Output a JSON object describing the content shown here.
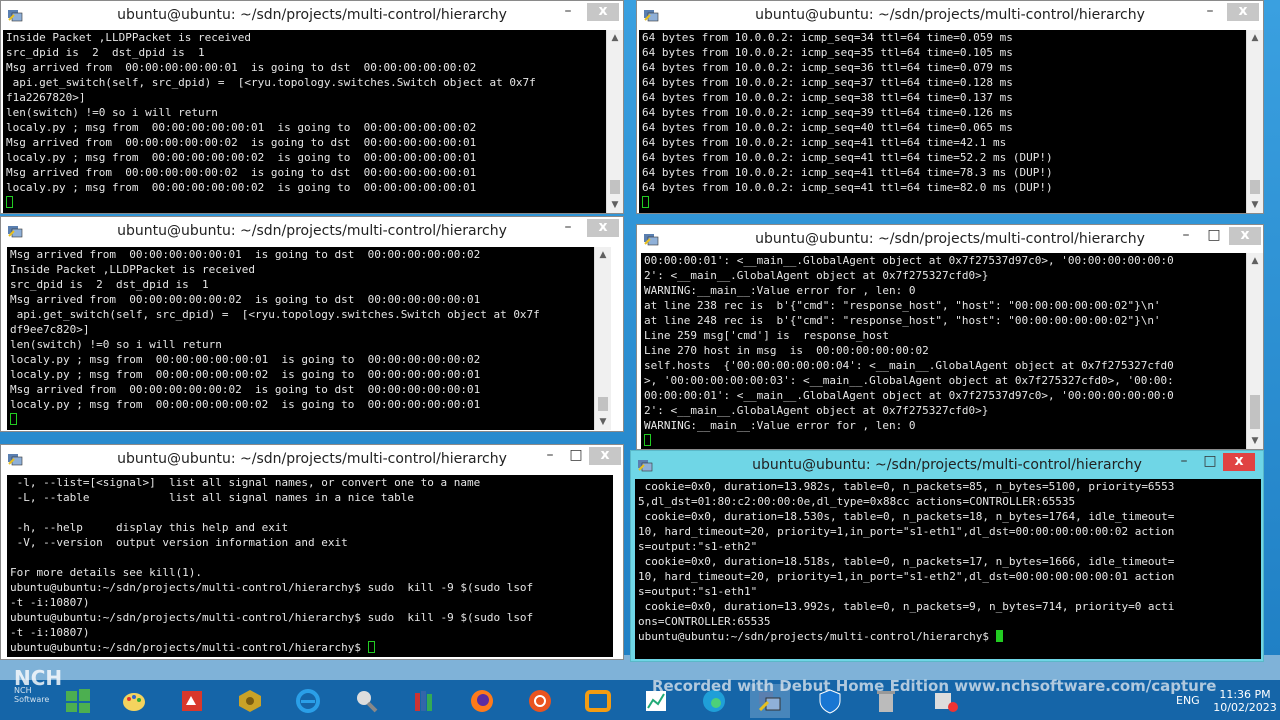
{
  "windows": [
    {
      "title": "ubuntu@ubuntu: ~/sdn/projects/multi-control/hierarchy",
      "lines": [
        "Inside Packet ,LLDPPacket is received",
        "src_dpid is  2  dst_dpid is  1",
        "Msg arrived from  00:00:00:00:00:01  is going to dst  00:00:00:00:00:02",
        " api.get_switch(self, src_dpid) =  [<ryu.topology.switches.Switch object at 0x7f",
        "f1a2267820>]",
        "len(switch) !=0 so i will return",
        "localy.py ; msg from  00:00:00:00:00:01  is going to  00:00:00:00:00:02",
        "Msg arrived from  00:00:00:00:00:02  is going to dst  00:00:00:00:00:01",
        "localy.py ; msg from  00:00:00:00:00:02  is going to  00:00:00:00:00:01",
        "Msg arrived from  00:00:00:00:00:02  is going to dst  00:00:00:00:00:01",
        "localy.py ; msg from  00:00:00:00:00:02  is going to  00:00:00:00:00:01"
      ]
    },
    {
      "title": "ubuntu@ubuntu: ~/sdn/projects/multi-control/hierarchy",
      "lines": [
        "64 bytes from 10.0.0.2: icmp_seq=34 ttl=64 time=0.059 ms",
        "64 bytes from 10.0.0.2: icmp_seq=35 ttl=64 time=0.105 ms",
        "64 bytes from 10.0.0.2: icmp_seq=36 ttl=64 time=0.079 ms",
        "64 bytes from 10.0.0.2: icmp_seq=37 ttl=64 time=0.128 ms",
        "64 bytes from 10.0.0.2: icmp_seq=38 ttl=64 time=0.137 ms",
        "64 bytes from 10.0.0.2: icmp_seq=39 ttl=64 time=0.126 ms",
        "64 bytes from 10.0.0.2: icmp_seq=40 ttl=64 time=0.065 ms",
        "64 bytes from 10.0.0.2: icmp_seq=41 ttl=64 time=42.1 ms",
        "64 bytes from 10.0.0.2: icmp_seq=41 ttl=64 time=52.2 ms (DUP!)",
        "64 bytes from 10.0.0.2: icmp_seq=41 ttl=64 time=78.3 ms (DUP!)",
        "64 bytes from 10.0.0.2: icmp_seq=41 ttl=64 time=82.0 ms (DUP!)"
      ]
    },
    {
      "title": "ubuntu@ubuntu: ~/sdn/projects/multi-control/hierarchy",
      "lines": [
        "Msg arrived from  00:00:00:00:00:01  is going to dst  00:00:00:00:00:02",
        "Inside Packet ,LLDPPacket is received",
        "src_dpid is  2  dst_dpid is  1",
        "Msg arrived from  00:00:00:00:00:02  is going to dst  00:00:00:00:00:01",
        " api.get_switch(self, src_dpid) =  [<ryu.topology.switches.Switch object at 0x7f",
        "df9ee7c820>]",
        "len(switch) !=0 so i will return",
        "localy.py ; msg from  00:00:00:00:00:01  is going to  00:00:00:00:00:02",
        "localy.py ; msg from  00:00:00:00:00:02  is going to  00:00:00:00:00:01",
        "Msg arrived from  00:00:00:00:00:02  is going to dst  00:00:00:00:00:01",
        "localy.py ; msg from  00:00:00:00:00:02  is going to  00:00:00:00:00:01"
      ]
    },
    {
      "title": "ubuntu@ubuntu: ~/sdn/projects/multi-control/hierarchy",
      "lines": [
        "00:00:00:01': <__main__.GlobalAgent object at 0x7f27537d97c0>, '00:00:00:00:00:0",
        "2': <__main__.GlobalAgent object at 0x7f275327cfd0>}",
        "WARNING:__main__:Value error for , len: 0",
        "at line 238 rec is  b'{\"cmd\": \"response_host\", \"host\": \"00:00:00:00:00:02\"}\\n'",
        "at line 248 rec is  b'{\"cmd\": \"response_host\", \"host\": \"00:00:00:00:00:02\"}\\n'",
        "Line 259 msg['cmd'] is  response_host",
        "Line 270 host in msg  is  00:00:00:00:00:02",
        "self.hosts  {'00:00:00:00:00:04': <__main__.GlobalAgent object at 0x7f275327cfd0",
        ">, '00:00:00:00:00:03': <__main__.GlobalAgent object at 0x7f275327cfd0>, '00:00:",
        "00:00:00:01': <__main__.GlobalAgent object at 0x7f27537d97c0>, '00:00:00:00:00:0",
        "2': <__main__.GlobalAgent object at 0x7f275327cfd0>}",
        "WARNING:__main__:Value error for , len: 0"
      ]
    },
    {
      "title": "ubuntu@ubuntu: ~/sdn/projects/multi-control/hierarchy",
      "lines": [
        " -l, --list=[<signal>]  list all signal names, or convert one to a name",
        " -L, --table            list all signal names in a nice table",
        "",
        " -h, --help     display this help and exit",
        " -V, --version  output version information and exit",
        "",
        "For more details see kill(1).",
        "ubuntu@ubuntu:~/sdn/projects/multi-control/hierarchy$ sudo  kill -9 $(sudo lsof",
        "-t -i:10807)",
        "ubuntu@ubuntu:~/sdn/projects/multi-control/hierarchy$ sudo  kill -9 $(sudo lsof",
        "-t -i:10807)",
        "ubuntu@ubuntu:~/sdn/projects/multi-control/hierarchy$ "
      ]
    },
    {
      "title": "ubuntu@ubuntu: ~/sdn/projects/multi-control/hierarchy",
      "lines": [
        " cookie=0x0, duration=13.982s, table=0, n_packets=85, n_bytes=5100, priority=6553",
        "5,dl_dst=01:80:c2:00:00:0e,dl_type=0x88cc actions=CONTROLLER:65535",
        " cookie=0x0, duration=18.530s, table=0, n_packets=18, n_bytes=1764, idle_timeout=",
        "10, hard_timeout=20, priority=1,in_port=\"s1-eth1\",dl_dst=00:00:00:00:00:02 action",
        "s=output:\"s1-eth2\"",
        " cookie=0x0, duration=18.518s, table=0, n_packets=17, n_bytes=1666, idle_timeout=",
        "10, hard_timeout=20, priority=1,in_port=\"s1-eth2\",dl_dst=00:00:00:00:00:01 action",
        "s=output:\"s1-eth1\"",
        " cookie=0x0, duration=13.992s, table=0, n_packets=9, n_bytes=714, priority=0 acti",
        "ons=CONTROLLER:65535",
        "ubuntu@ubuntu:~/sdn/projects/multi-control/hierarchy$ "
      ]
    }
  ],
  "controls": {
    "minimize": "–",
    "maximize": "□",
    "close": "x"
  },
  "scroll_arrows": {
    "up": "▲",
    "down": "▼"
  },
  "watermark": "Recorded with Debut Home Edition  www.nchsoftware.com/capture",
  "nch_logo": {
    "text": "NCH",
    "sub": "NCH Software"
  },
  "tray": {
    "lang": "ENG",
    "time": "11:36 PM",
    "date": "10/02/2023"
  },
  "taskbar_icons": [
    "windows-start-icon",
    "paint-icon",
    "presentation-icon",
    "security-icon",
    "internet-explorer-icon",
    "tool-icon",
    "books-icon",
    "firefox-icon",
    "ubuntu-icon",
    "vm-icon",
    "chart-icon",
    "edge-icon",
    "putty-icon",
    "shield-icon",
    "recycle-icon",
    "recorder-icon"
  ],
  "colors": {
    "active_title": "#6fd6e6",
    "close_active": "#e04343",
    "cursor": "#22cc22",
    "taskbar": "#1565a8"
  }
}
